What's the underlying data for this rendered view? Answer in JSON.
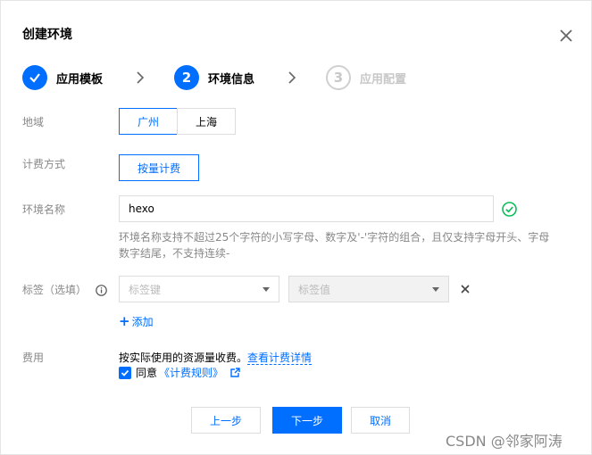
{
  "dialog": {
    "title": "创建环境"
  },
  "steps": [
    {
      "number": "",
      "label": "应用模板",
      "state": "done"
    },
    {
      "number": "2",
      "label": "环境信息",
      "state": "active"
    },
    {
      "number": "3",
      "label": "应用配置",
      "state": "todo"
    }
  ],
  "region": {
    "label": "地域",
    "options": [
      "广州",
      "上海"
    ],
    "selected": "广州"
  },
  "billing": {
    "label": "计费方式",
    "option": "按量计费"
  },
  "env_name": {
    "label": "环境名称",
    "value": "hexo",
    "hint": "环境名称支持不超过25个字符的小写字母、数字及'-'字符的组合，且仅支持字母开头、字母数字结尾，不支持连续-"
  },
  "tags": {
    "label": "标签（选填）",
    "key_placeholder": "标签键",
    "value_placeholder": "标签值",
    "add_label": "添加",
    "add_prefix": "+"
  },
  "fee": {
    "label": "费用",
    "text": "按实际使用的资源量收费。",
    "link": "查看计费详情",
    "agree_text": "同意",
    "rules_link": "《计费规则》"
  },
  "footer": {
    "prev": "上一步",
    "next": "下一步",
    "cancel": "取消"
  },
  "watermark": "CSDN @邻家阿涛",
  "colors": {
    "accent": "#006eff",
    "success": "#0abf5b"
  }
}
